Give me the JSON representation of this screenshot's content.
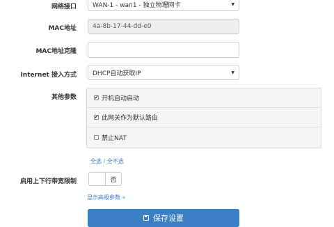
{
  "form": {
    "interface": {
      "label": "网络接口",
      "value": "WAN-1 - wan1 - 独立物理网卡"
    },
    "mac": {
      "label": "MAC地址",
      "value": "4a-8b-17-44-dd-e0"
    },
    "mac_clone": {
      "label": "MAC地址克隆",
      "value": ""
    },
    "internet_mode": {
      "label": "Internet 接入方式",
      "value": "DHCP自动获取IP"
    },
    "other_params": {
      "label": "其他参数",
      "options": [
        {
          "label": "开机自动启动",
          "checked": true
        },
        {
          "label": "此网关作为默认路由",
          "checked": true
        },
        {
          "label": "禁止NAT",
          "checked": false
        }
      ]
    },
    "select_all": "全选 / 全不选",
    "bandwidth_limit": {
      "label": "启用上下行带宽限制",
      "toggle_text": "否",
      "enabled": false
    },
    "advanced_link": "显示高级参数 »",
    "save_button": "保存设置"
  },
  "colors": {
    "accent": "#3a7fc4",
    "disabled_bg": "#eeeeee",
    "group_bg": "#f5f5f5"
  },
  "icons": {
    "save": "floppy-disk-icon",
    "check": "checkmark-icon",
    "caret": "caret-down-icon"
  }
}
